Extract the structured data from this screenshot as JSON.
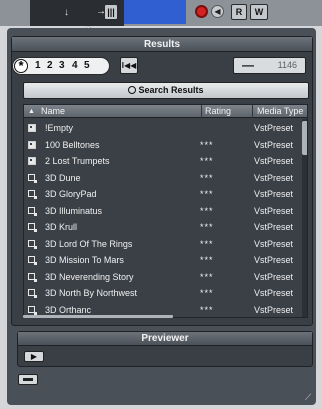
{
  "transport": {
    "record_icon": "record-icon",
    "monitor_icon": "speaker-icon",
    "monitor_glyph": "◀",
    "read_label": "R",
    "write_label": "W",
    "in_arrow": "↓",
    "out_arrow": "→",
    "cursor_glyph": "➤"
  },
  "results": {
    "title": "Results",
    "rating_filter": {
      "star": "*",
      "levels": [
        "1",
        "2",
        "3",
        "4",
        "5"
      ]
    },
    "reset_label": "I◀◀",
    "count_prefix": "—",
    "count_value": "1146",
    "search_label": "Search Results",
    "columns": {
      "name": "Name",
      "rating": "Rating",
      "media_type": "Media Type",
      "sort_glyph": "▲"
    },
    "rows": [
      {
        "icon": "folder",
        "name": "!Empty",
        "rating": "",
        "media_type": "VstPreset"
      },
      {
        "icon": "folder",
        "name": "100 Belltones",
        "rating": "***",
        "media_type": "VstPreset"
      },
      {
        "icon": "folder",
        "name": "2 Lost Trumpets",
        "rating": "***",
        "media_type": "VstPreset"
      },
      {
        "icon": "preset",
        "name": "3D Dune",
        "rating": "***",
        "media_type": "VstPreset"
      },
      {
        "icon": "preset",
        "name": "3D GloryPad",
        "rating": "***",
        "media_type": "VstPreset"
      },
      {
        "icon": "preset",
        "name": "3D Illuminatus",
        "rating": "***",
        "media_type": "VstPreset"
      },
      {
        "icon": "preset",
        "name": "3D Krull",
        "rating": "***",
        "media_type": "VstPreset"
      },
      {
        "icon": "preset",
        "name": "3D Lord Of The Rings",
        "rating": "***",
        "media_type": "VstPreset"
      },
      {
        "icon": "preset",
        "name": "3D Mission To Mars",
        "rating": "***",
        "media_type": "VstPreset"
      },
      {
        "icon": "preset",
        "name": "3D Neverending Story",
        "rating": "***",
        "media_type": "VstPreset"
      },
      {
        "icon": "preset",
        "name": "3D North By Northwest",
        "rating": "***",
        "media_type": "VstPreset"
      },
      {
        "icon": "preset",
        "name": "3D Orthanc",
        "rating": "***",
        "media_type": "VstPreset"
      }
    ]
  },
  "previewer": {
    "title": "Previewer",
    "play_glyph": "▶"
  },
  "colors": {
    "panel": "#4a5057",
    "record": "#d42121",
    "transport_blue": "#2f5fd1"
  }
}
